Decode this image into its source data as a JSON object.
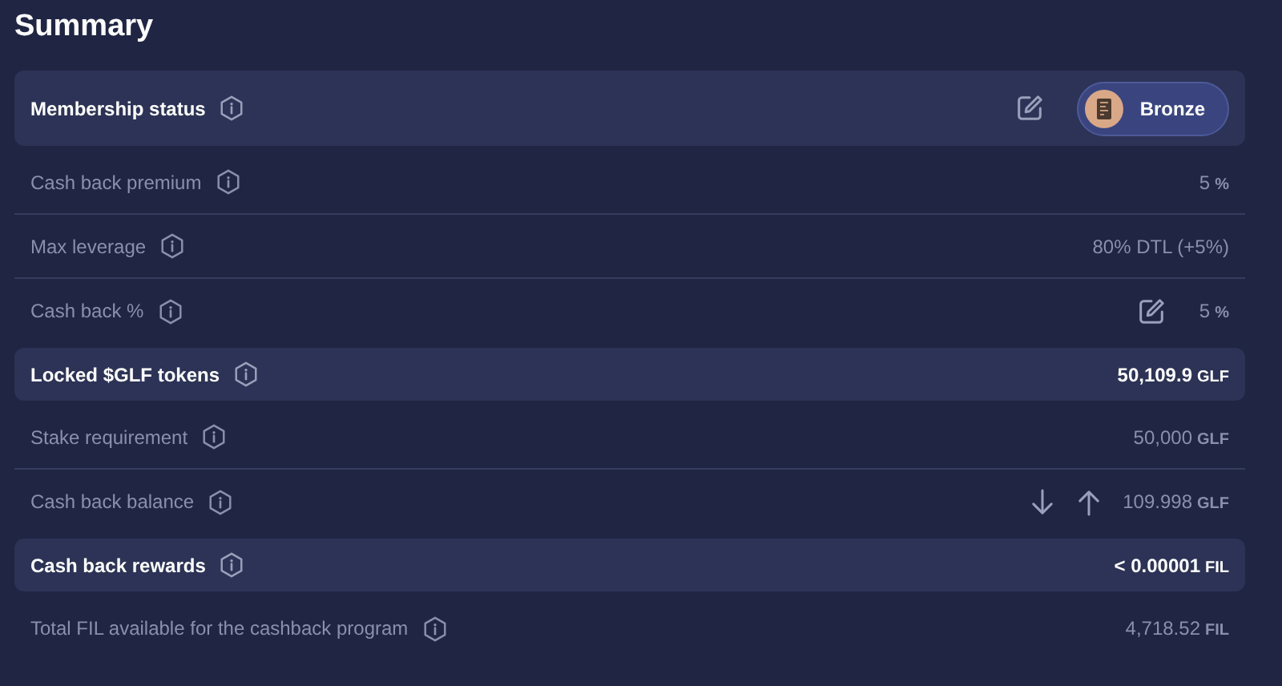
{
  "title": "Summary",
  "rows": [
    {
      "kind": "header",
      "label": "Membership status",
      "edit": true,
      "badge": {
        "label": "Bronze"
      }
    },
    {
      "kind": "item",
      "label": "Cash back premium",
      "value": "5",
      "unit": "%"
    },
    {
      "kind": "item",
      "label": "Max leverage",
      "value": "80% DTL (+5%)"
    },
    {
      "kind": "item",
      "label": "Cash back %",
      "edit": true,
      "value": "5",
      "unit": "%"
    },
    {
      "kind": "header",
      "label": "Locked $GLF tokens",
      "value": "50,109.9",
      "unit": "GLF"
    },
    {
      "kind": "item",
      "label": "Stake requirement",
      "value": "50,000",
      "unit": "GLF"
    },
    {
      "kind": "item",
      "label": "Cash back balance",
      "transfer": true,
      "value": "109.998",
      "unit": "GLF"
    },
    {
      "kind": "header",
      "label": "Cash back rewards",
      "value": "< 0.00001",
      "unit": "FIL"
    },
    {
      "kind": "item",
      "label": "Total FIL available for the cashback program",
      "value": "4,718.52",
      "unit": "FIL"
    }
  ]
}
